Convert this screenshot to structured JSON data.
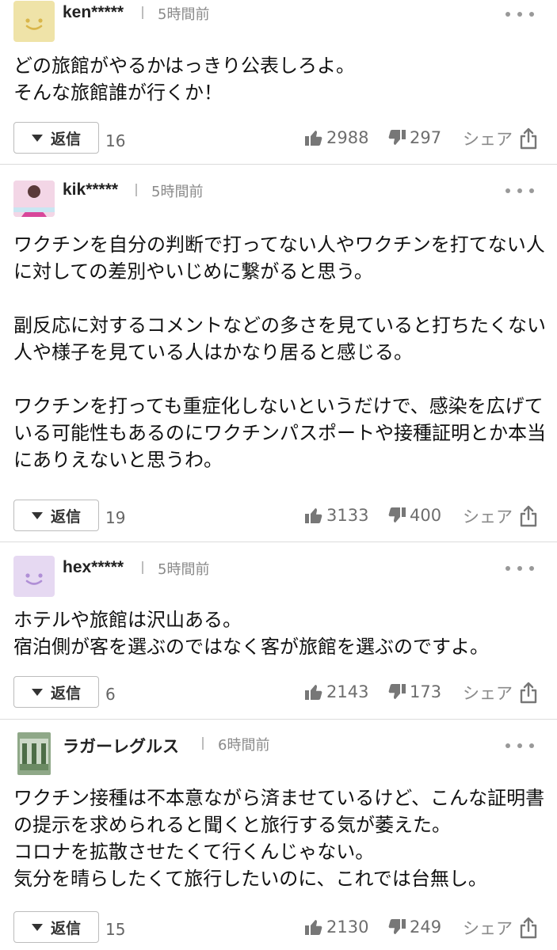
{
  "comments": [
    {
      "username": "ken*****",
      "time": "5時間前",
      "body": "どの旅館がやるかはっきり公表しろよ。\nそんな旅館誰が行くか！",
      "reply_label": "返信",
      "reply_count": "16",
      "likes": "2988",
      "dislikes": "297",
      "share_label": "シェア",
      "avatar_color": "#efe3a8"
    },
    {
      "username": "kik*****",
      "time": "5時間前",
      "body": "ワクチンを自分の判断で打ってない人やワクチンを打てない人に対しての差別やいじめに繋がると思う。\n\n副反応に対するコメントなどの多さを見ていると打ちたくない人や様子を見ている人はかなり居ると感じる。\n\nワクチンを打っても重症化しないというだけで、感染を広げている可能性もあるのにワクチンパスポートや接種証明とか本当にありえないと思うわ。",
      "reply_label": "返信",
      "reply_count": "19",
      "likes": "3133",
      "dislikes": "400",
      "share_label": "シェア",
      "avatar_color": "#f3d6e6"
    },
    {
      "username": "hex*****",
      "time": "5時間前",
      "body": "ホテルや旅館は沢山ある。\n宿泊側が客を選ぶのではなく客が旅館を選ぶのですよ。",
      "reply_label": "返信",
      "reply_count": "6",
      "likes": "2143",
      "dislikes": "173",
      "share_label": "シェア",
      "avatar_color": "#e6d9f2"
    },
    {
      "username": "ラガーレグルス",
      "time": "6時間前",
      "body": "ワクチン接種は不本意ながら済ませているけど、こんな証明書の提示を求められると聞くと旅行する気が萎えた。\nコロナを拡散させたくて行くんじゃない。\n気分を晴らしたくて旅行したいのに、これでは台無し。",
      "reply_label": "返信",
      "reply_count": "15",
      "likes": "2130",
      "dislikes": "249",
      "share_label": "シェア",
      "avatar_color": "#dfe9d6"
    }
  ]
}
